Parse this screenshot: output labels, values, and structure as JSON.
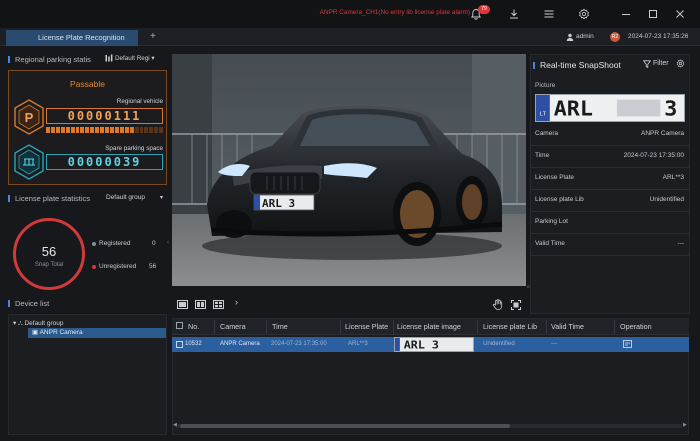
{
  "header": {
    "alarm_text": "ANPR Camera_CH1(No entry lib license plate alarm)",
    "alarm_count": "79",
    "username": "admin",
    "avatar_initials": "R2",
    "datetime": "2024-07-23 17:35:26"
  },
  "tabs": {
    "active": "License Plate Recognition",
    "add": "+"
  },
  "regional": {
    "title": "Regional parking statis",
    "dropdown": "Default Regi",
    "status": "Passable",
    "regional_vehicle_label": "Regional vehicle",
    "regional_vehicle_count": "00000111",
    "spare_label": "Spare parking space",
    "spare_count": "00000039",
    "occupancy_fraction": 0.74
  },
  "plate_stats": {
    "title": "License plate statistics",
    "group": "Default group",
    "snap_total": "56",
    "snap_total_label": "Snap Total",
    "registered_label": "Registered",
    "registered_value": "0",
    "unregistered_label": "Unregistered",
    "unregistered_value": "56"
  },
  "device_list": {
    "title": "Device list",
    "group": "Default group",
    "camera": "ANPR Camera"
  },
  "video": {
    "plate_text": "ARL 3",
    "watermark": "BLURRY"
  },
  "table": {
    "headers": [
      "No.",
      "Camera",
      "Time",
      "License Plate",
      "License plate image",
      "License plate Lib",
      "Valid Time",
      "Operation"
    ],
    "row": {
      "no": "10532",
      "camera": "ANPR Camera",
      "time": "2024-07-23 17:35:00",
      "plate": "ARL**3",
      "plate_image_text": "ARL 3",
      "lib": "Unidentified",
      "valid_time": "---"
    }
  },
  "snapshot": {
    "title": "Real-time SnapShoot",
    "filter_label": "Filter",
    "picture_label": "Picture",
    "plate_image_text": "ARL",
    "plate_image_suffix": "3",
    "plate_region": "LT",
    "fields": [
      {
        "k": "Camera",
        "v": "ANPR Camera"
      },
      {
        "k": "Time",
        "v": "2024-07-23 17:35:00"
      },
      {
        "k": "License Plate",
        "v": "ARL**3"
      },
      {
        "k": "License plate Lib",
        "v": "Unidentified"
      },
      {
        "k": "Parking Lot",
        "v": ""
      },
      {
        "k": "Valid Time",
        "v": "---"
      }
    ]
  },
  "colors": {
    "accent": "#2c5fa0",
    "orange": "#e0782a",
    "cyan": "#2aa3b8",
    "alarm": "#e0363a"
  }
}
